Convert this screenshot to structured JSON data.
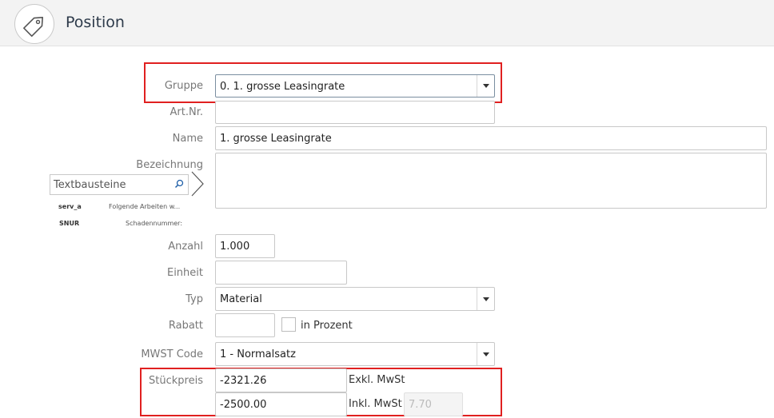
{
  "header": {
    "title": "Position",
    "icon": "tag-icon"
  },
  "form": {
    "gruppe": {
      "label": "Gruppe",
      "value": "0. 1. grosse Leasingrate"
    },
    "artnr": {
      "label": "Art.Nr.",
      "value": ""
    },
    "name": {
      "label": "Name",
      "value": "1. grosse Leasingrate"
    },
    "bezeichnung": {
      "label": "Bezeichnung",
      "value": ""
    },
    "anzahl": {
      "label": "Anzahl",
      "value": "1.000"
    },
    "einheit": {
      "label": "Einheit",
      "value": ""
    },
    "typ": {
      "label": "Typ",
      "value": "Material"
    },
    "rabatt": {
      "label": "Rabatt",
      "value": "",
      "checkbox_label": "in Prozent"
    },
    "mwst_code": {
      "label": "MWST Code",
      "value": "1 - Normalsatz"
    },
    "stueckpreis": {
      "label": "Stückpreis",
      "exkl_value": "-2321.26",
      "exkl_label": "Exkl. MwSt",
      "inkl_value": "-2500.00",
      "inkl_label": "Inkl. MwSt",
      "rate_value": "7.70"
    }
  },
  "textbausteine": {
    "placeholder": "Textbausteine",
    "items": [
      {
        "code": "serv_a",
        "description": "Folgende Arbeiten w..."
      },
      {
        "code": "SNUR",
        "description": "Schadennummer:"
      }
    ]
  },
  "colors": {
    "highlight": "#e02020",
    "title": "#2d3a4a"
  }
}
